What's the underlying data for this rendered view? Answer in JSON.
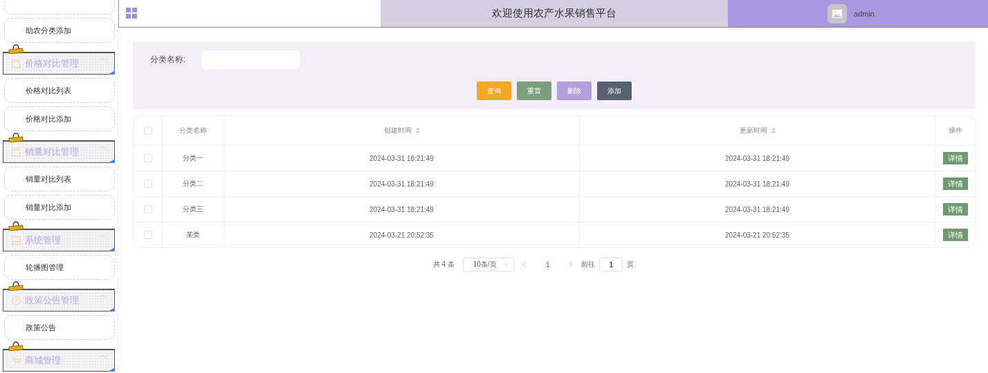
{
  "sidebar": [
    {
      "kind": "item"
    },
    {
      "kind": "item",
      "label": "助农分类添加"
    },
    {
      "kind": "group",
      "label": "价格对比管理",
      "expanded": true
    },
    {
      "kind": "item",
      "label": "价格对比列表"
    },
    {
      "kind": "item",
      "label": "价格对比添加"
    },
    {
      "kind": "group",
      "label": "销量对比管理",
      "expanded": true
    },
    {
      "kind": "item",
      "label": "销量对比列表"
    },
    {
      "kind": "item",
      "label": "销量对比添加"
    },
    {
      "kind": "group",
      "label": "系统管理",
      "expanded": true
    },
    {
      "kind": "item",
      "label": "轮播图管理"
    },
    {
      "kind": "group",
      "label": "政策公告管理",
      "expanded": true
    },
    {
      "kind": "item",
      "label": "政策公告"
    },
    {
      "kind": "group",
      "label": "商城管理",
      "expanded": true
    }
  ],
  "header": {
    "title": "欢迎使用农产水果销售平台",
    "user": "admin"
  },
  "search": {
    "label": "分类名称:",
    "buttons": [
      {
        "label": "查询",
        "color": "#f5a623"
      },
      {
        "label": "重置",
        "color": "#7b9e7d"
      },
      {
        "label": "删除",
        "color": "#b39ddb"
      },
      {
        "label": "添加",
        "color": "#56636e"
      }
    ]
  },
  "table": {
    "select_all_checked": false,
    "columns": [
      {
        "label": "分类名称",
        "sortable": false
      },
      {
        "label": "创建时间",
        "sortable": true
      },
      {
        "label": "更新时间",
        "sortable": true
      },
      {
        "label": "操作",
        "sortable": false
      }
    ],
    "rows": [
      {
        "checked": false,
        "name": "分类一",
        "created": "2024-03-31 18:21:49",
        "updated": "2024-03-31 18:21:49",
        "action": "详情"
      },
      {
        "checked": false,
        "name": "分类二",
        "created": "2024-03-31 18:21:49",
        "updated": "2024-03-31 18:21:49",
        "action": "详情"
      },
      {
        "checked": false,
        "name": "分类三",
        "created": "2024-03-31 18:21:49",
        "updated": "2024-03-31 18:21:49",
        "action": "详情"
      },
      {
        "checked": false,
        "name": "某类",
        "created": "2024-03-21 20:52:35",
        "updated": "2024-03-21 20:52:35",
        "action": "详情"
      }
    ]
  },
  "pagination": {
    "total": "共 4 条",
    "page_size": "10条/页",
    "pages": [
      {
        "label": "1",
        "selected": true
      }
    ],
    "goto_label": "前往",
    "goto_value": "1",
    "goto_unit": "页"
  }
}
